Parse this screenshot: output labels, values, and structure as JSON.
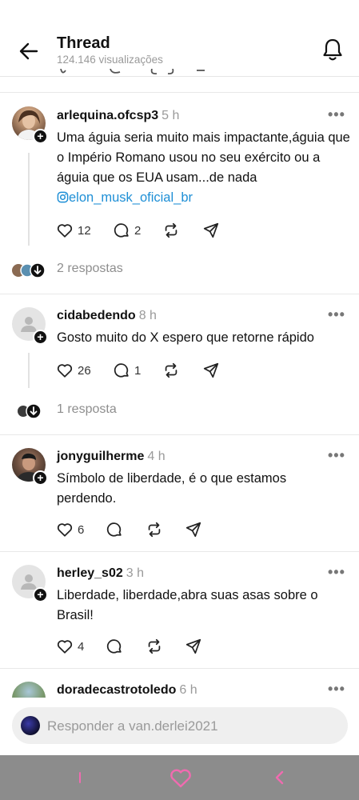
{
  "header": {
    "title": "Thread",
    "views": "124.146 visualizações"
  },
  "comments": [
    {
      "username": "arlequina.ofcsp3",
      "time": "5 h",
      "text": "Uma águia seria muito mais impactante,águia que o Império Romano usou no seu exército ou a águia que os EUA usam...de nada",
      "mention": "elon_musk_oficial_br",
      "likes": "12",
      "comments": "2",
      "replies_label": "2 respostas"
    },
    {
      "username": "cidabedendo",
      "time": "8 h",
      "text": "Gosto muito do X espero que retorne rápido",
      "likes": "26",
      "comments": "1",
      "replies_label": "1 resposta"
    },
    {
      "username": "jonyguilherme",
      "time": "4 h",
      "text": "Símbolo de liberdade, é o que estamos perdendo.",
      "likes": "6"
    },
    {
      "username": "herley_s02",
      "time": "3 h",
      "text": "Liberdade, liberdade,abra suas asas sobre o Brasil!",
      "likes": "4"
    },
    {
      "username": "doradecastrotoledo",
      "time": "6 h"
    }
  ],
  "more_label": "•••",
  "reply": {
    "placeholder": "Responder a van.derlei2021"
  },
  "colors": {
    "mention": "#1e8fd6",
    "secondary_text": "#9a9a9a",
    "system_bar": "#8c8c8c",
    "system_accent": "#f06bb0"
  },
  "icons": {
    "back": "arrow-left-icon",
    "bell": "bell-icon",
    "like": "heart-icon",
    "comment": "speech-bubble-icon",
    "repost": "repost-icon",
    "share": "send-icon",
    "more": "more-horizontal-icon"
  }
}
